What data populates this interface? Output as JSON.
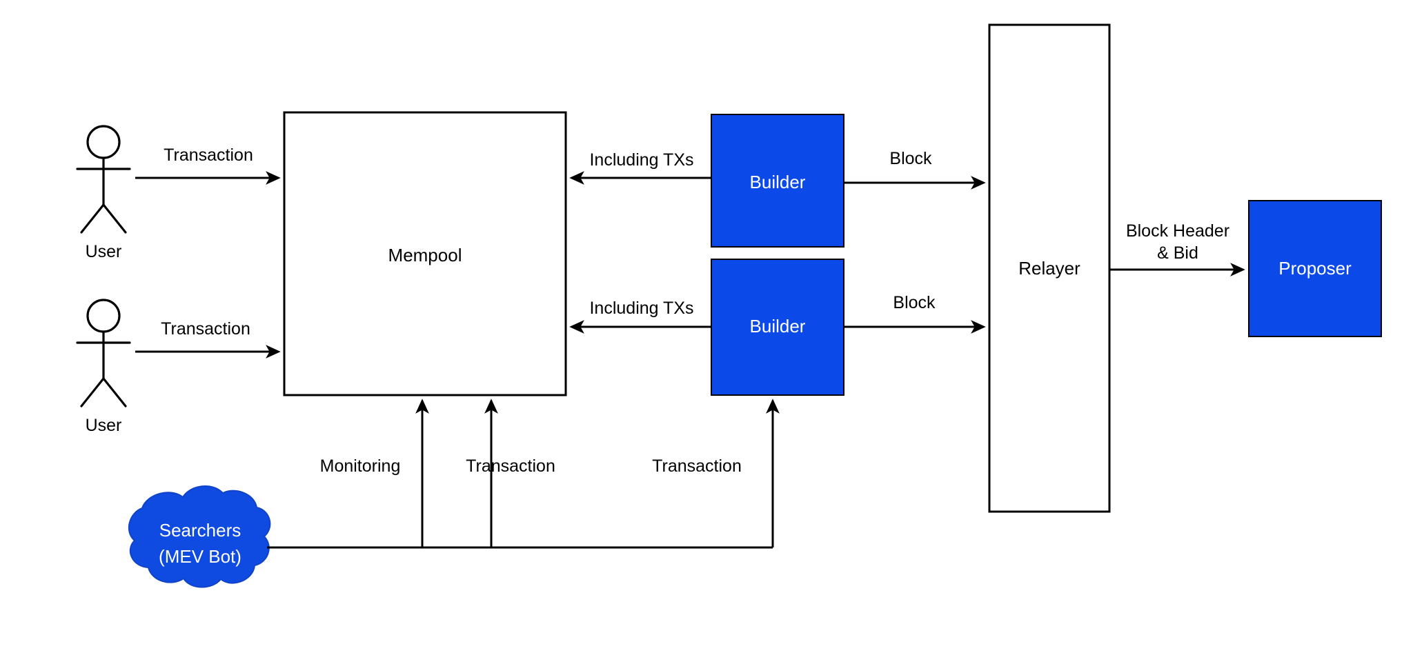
{
  "diagram": {
    "title": "MEV-Boost / Proposer-Builder Separation flow",
    "colors": {
      "accent_blue": "#0B49E8",
      "cloud_blue": "#0F4BE0",
      "stroke_black": "#000000",
      "canvas_white": "#FFFFFF",
      "label_white": "#FFFFFF"
    },
    "nodes": {
      "user_top": {
        "label": "User",
        "shape": "actor"
      },
      "user_bottom": {
        "label": "User",
        "shape": "actor"
      },
      "mempool": {
        "label": "Mempool",
        "shape": "rectangle-outline"
      },
      "builder_top": {
        "label": "Builder",
        "shape": "rectangle-filled"
      },
      "builder_bottom": {
        "label": "Builder",
        "shape": "rectangle-filled"
      },
      "relayer": {
        "label": "Relayer",
        "shape": "rectangle-outline"
      },
      "proposer": {
        "label": "Proposer",
        "shape": "rectangle-filled"
      },
      "searchers": {
        "label_line1": "Searchers",
        "label_line2": "(MEV Bot)",
        "shape": "cloud"
      }
    },
    "edges": {
      "user_top_to_mempool": {
        "label": "Transaction"
      },
      "user_bottom_to_mempool": {
        "label": "Transaction"
      },
      "builder_top_to_mempool": {
        "label": "Including TXs"
      },
      "builder_bottom_to_mempool": {
        "label": "Including TXs"
      },
      "builder_top_to_relayer": {
        "label": "Block"
      },
      "builder_bottom_to_relayer": {
        "label": "Block"
      },
      "relayer_to_proposer": {
        "label_line1": "Block Header",
        "label_line2": "& Bid"
      },
      "searchers_monitoring": {
        "label": "Monitoring"
      },
      "searchers_tx_mempool": {
        "label": "Transaction"
      },
      "searchers_tx_builder": {
        "label": "Transaction"
      }
    }
  }
}
